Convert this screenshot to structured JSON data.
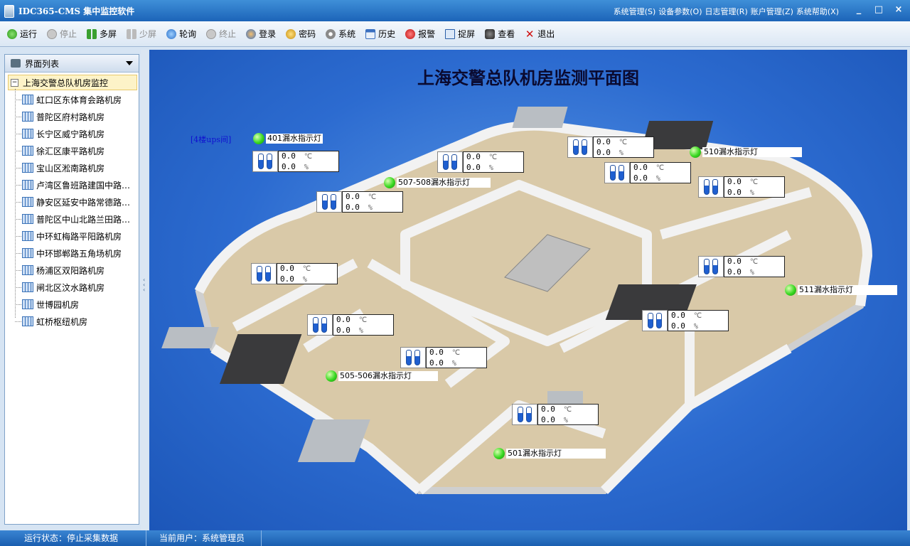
{
  "window": {
    "title": "IDC365-CMS 集中监控软件",
    "menus": [
      "系统管理(S)",
      "设备参数(O)",
      "日志管理(R)",
      "账户管理(Z)",
      "系统帮助(X)"
    ],
    "controls": [
      "_",
      "□",
      "×"
    ]
  },
  "toolbar": {
    "run": "运行",
    "stop": "停止",
    "multi_screen": "多屏",
    "less_screen": "少屏",
    "poll": "轮询",
    "terminate": "终止",
    "login": "登录",
    "password": "密码",
    "system": "系统",
    "history": "历史",
    "alarm": "报警",
    "capture": "捉屏",
    "view": "查看",
    "exit": "退出"
  },
  "sidebar": {
    "header": "界面列表",
    "root": "上海交警总队机房监控",
    "items": [
      "虹口区东体育会路机房",
      "普陀区府村路机房",
      "长宁区威宁路机房",
      "徐汇区康平路机房",
      "宝山区淞南路机房",
      "卢湾区鲁班路建国中路机房",
      "静安区延安中路常德路机房",
      "普陀区中山北路兰田路机房",
      "中环虹梅路平阳路机房",
      "中环邯郸路五角场机房",
      "杨浦区双阳路机房",
      "闸北区汶水路机房",
      "世博园机房",
      "虹桥枢纽机房"
    ]
  },
  "map": {
    "title": "上海交警总队机房监测平面图",
    "ups_label": "[4楼ups间]",
    "temp_reading": "0.0",
    "temp_unit": "℃",
    "humidity_reading": "0.0",
    "humidity_unit": "%",
    "leak_labels": {
      "l401": "401漏水指示灯",
      "l507": "507-508漏水指示灯",
      "l510": "510漏水指示灯",
      "l511": "511漏水指示灯",
      "l505": "505-506漏水指示灯",
      "l501": "501漏水指示灯"
    }
  },
  "status": {
    "run_state": "运行状态：停止采集数据",
    "current_user": "当前用户：系统管理员"
  }
}
